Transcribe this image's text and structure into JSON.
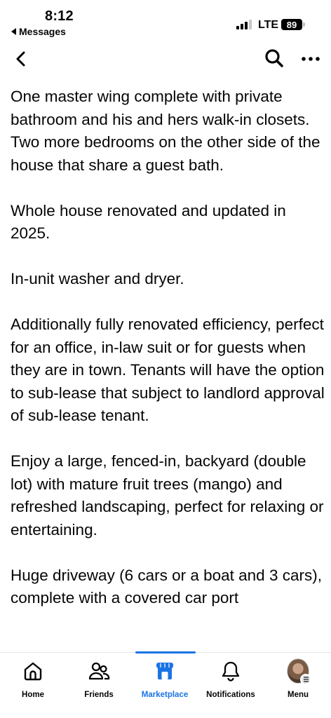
{
  "status_bar": {
    "time": "8:12",
    "back_app": "Messages",
    "network": "LTE",
    "battery": "89"
  },
  "nav": {
    "back_icon": "chevron-left-icon",
    "search_icon": "search-icon",
    "more_icon": "more-horizontal-icon"
  },
  "description": {
    "paragraphs": [
      "One master wing complete with private bathroom and his and hers walk-in closets. Two more bedrooms on the other side of the house that share a guest bath.",
      "Whole house renovated and updated in 2025.",
      "In-unit washer and dryer.",
      "Additionally fully renovated efficiency, perfect for an office, in-law suit or for guests when they are in town. Tenants will have the option to sub-lease that subject to landlord approval of sub-lease tenant.",
      "Enjoy a large, fenced-in, backyard (double lot) with mature fruit trees (mango) and refreshed landscaping, perfect for relaxing or entertaining.",
      "Huge driveway (6 cars or a boat and 3 cars), complete with a covered car port"
    ]
  },
  "tabs": [
    {
      "label": "Home",
      "icon": "home-icon"
    },
    {
      "label": "Friends",
      "icon": "friends-icon"
    },
    {
      "label": "Marketplace",
      "icon": "marketplace-icon",
      "active": true
    },
    {
      "label": "Notifications",
      "icon": "bell-icon"
    },
    {
      "label": "Menu",
      "icon": "avatar"
    }
  ],
  "colors": {
    "accent": "#1b74e4",
    "text": "#050505",
    "divider": "#e4e6eb"
  }
}
